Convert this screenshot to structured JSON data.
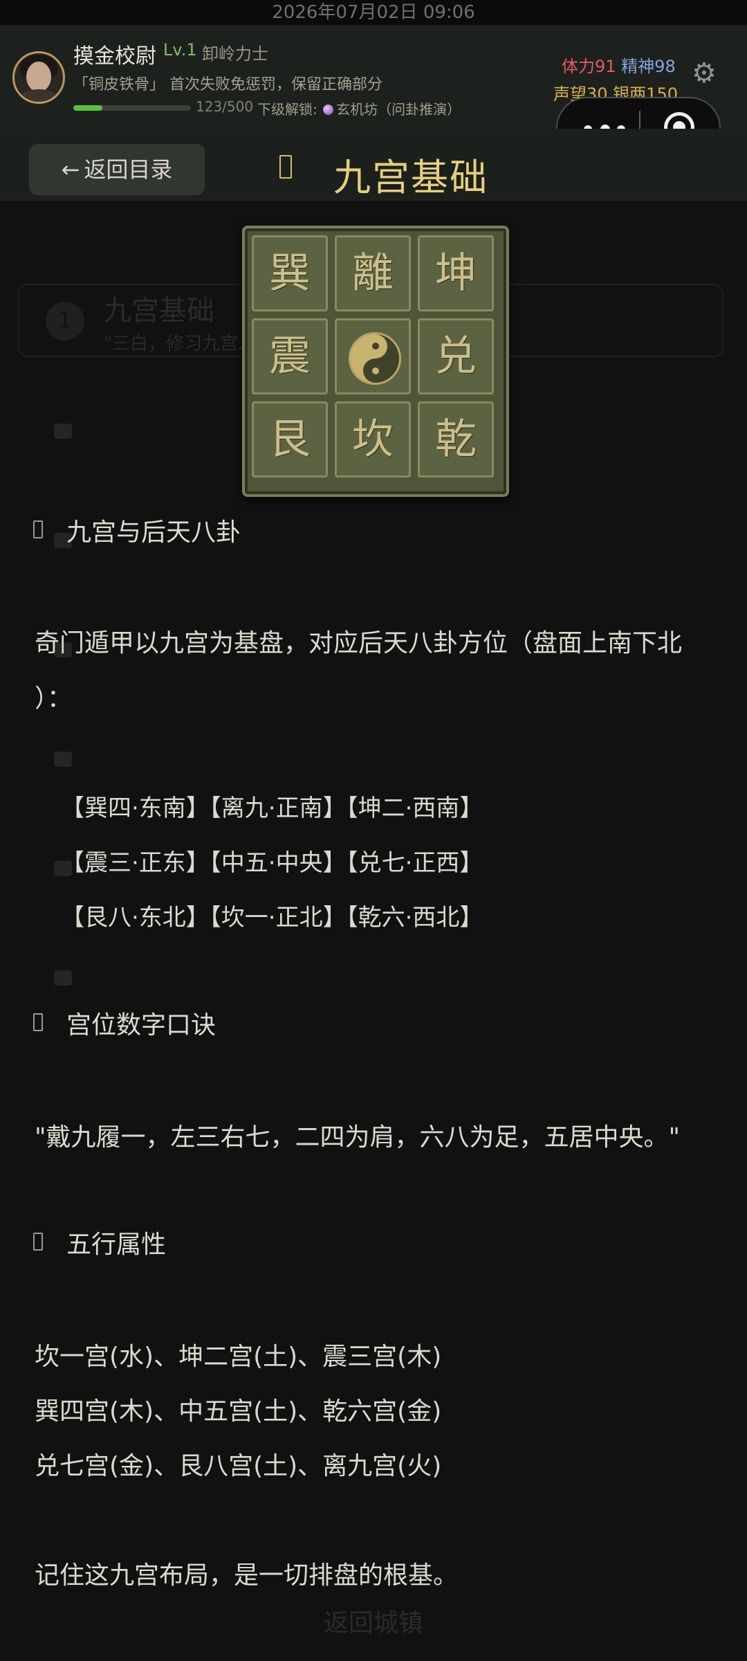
{
  "status_bar": {
    "datetime": "2026年07月02日 09:06"
  },
  "header": {
    "name": "摸金校尉",
    "level": "Lv.1",
    "rank": "卸岭力士",
    "perk": "「铜皮铁骨」 首次失败免惩罚，保留正确部分",
    "xp": {
      "current": 123,
      "max": 500,
      "text": "123/500"
    },
    "unlock_prefix": "下级解锁:",
    "unlock_target": "玄机坊（问卦推演）",
    "stats": {
      "stamina": "体力91",
      "spirit": "精神98",
      "reputation": "声望30",
      "silver": "银两150"
    },
    "settings_icon": "gear-icon"
  },
  "capsule": {
    "more_icon": "more-dots-icon",
    "close_icon": "target-close-icon"
  },
  "nav": {
    "back_label": "返回目录",
    "back_arrow": "←",
    "page_title": "九宫基础"
  },
  "background_list": {
    "first_item": {
      "number": "1",
      "title": "九宫基础",
      "subtitle": "\"三白，修习九宫八卦方位，方可地万"
    },
    "bottom_link": "返回城镇"
  },
  "board": {
    "cells": [
      "巽",
      "離",
      "坤",
      "震",
      "",
      "兑",
      "艮",
      "坎",
      "乾"
    ],
    "center_icon": "yin-yang-icon",
    "colors": {
      "bronze": "#5c6342",
      "gold": "#cdbf8a"
    }
  },
  "article": {
    "section1_title": "九宫与后天八卦",
    "intro_line1": "奇门遁甲以九宫为基盘，对应后天八卦方位（盘面上南下北",
    "intro_line2": "）：",
    "bagua_rows": [
      "【巽四·东南】【离九·正南】【坤二·西南】",
      "【震三·正东】【中五·中央】【兑七·正西】",
      "【艮八·东北】【坎一·正北】【乾六·西北】"
    ],
    "section2_title": "宫位数字口诀",
    "mnemonic": "\"戴九履一，左三右七，二四为肩，六八为足，五居中央。\"",
    "section3_title": "五行属性",
    "elements": [
      "坎一宫(水)、坤二宫(土)、震三宫(木)",
      "巽四宫(木)、中五宫(土)、乾六宫(金)",
      "兑七宫(金)、艮八宫(土)、离九宫(火)"
    ],
    "closing": "记住这九宫布局，是一切排盘的根基。"
  },
  "colors": {
    "background": "#101110",
    "title_gold": "#e6cf7c",
    "level_green": "#7fbf5a",
    "stamina_red": "#e25c5c",
    "spirit_blue": "#7fa7e0",
    "currency_gold": "#d8b24a"
  }
}
